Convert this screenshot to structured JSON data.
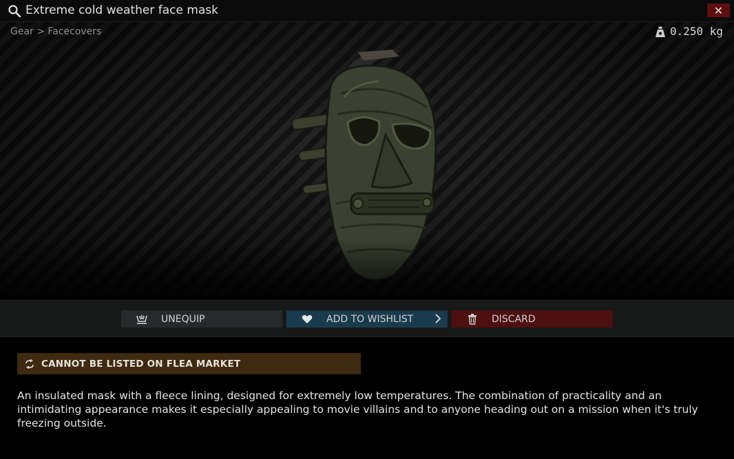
{
  "window": {
    "title": "Extreme cold weather face mask",
    "close_label": "✕"
  },
  "breadcrumb": "Gear > Facecovers",
  "weight": "0.250 kg",
  "actions": {
    "unequip": "UNEQUIP",
    "wishlist": "ADD TO WISHLIST",
    "discard": "DISCARD"
  },
  "flea_notice": "CANNOT BE LISTED ON FLEA MARKET",
  "description": "An insulated mask with a fleece lining, designed for extremely low temperatures. The combination of practicality and an intimidating appearance makes it especially appealing to movie villains and to anyone heading out on a mission when it's truly freezing outside.",
  "colors": {
    "close": "#5e0f0f",
    "unequip": "#272a2a",
    "wishlist": "#1a3a4d",
    "discard": "#4d0f10",
    "flea_banner": "#3e2a10"
  },
  "icons": [
    "search-icon",
    "close-icon",
    "weight-icon",
    "unequip-icon",
    "heart-icon",
    "chevron-right-icon",
    "trash-icon",
    "exchange-icon"
  ]
}
